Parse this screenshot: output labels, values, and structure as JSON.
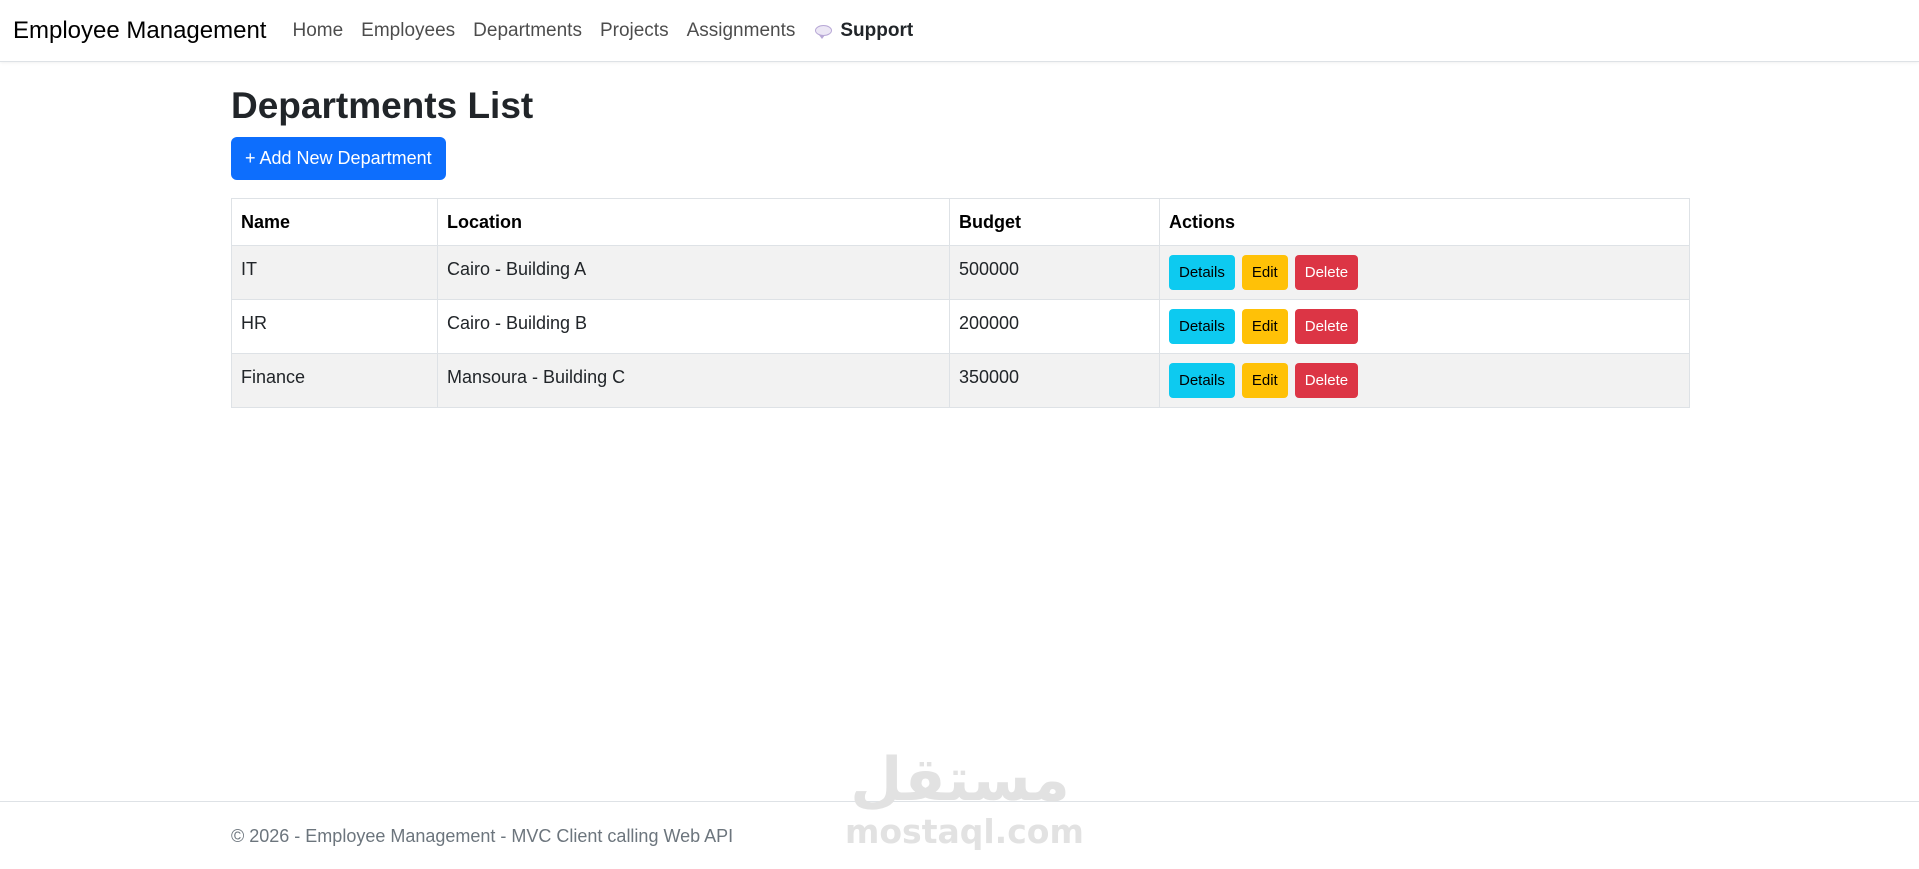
{
  "navbar": {
    "brand": "Employee Management",
    "links": [
      "Home",
      "Employees",
      "Departments",
      "Projects",
      "Assignments"
    ],
    "support": {
      "label": "Support",
      "icon": "speech-bubble-icon"
    }
  },
  "main": {
    "title": "Departments List",
    "add_button": "+ Add New Department",
    "table": {
      "headers": [
        "Name",
        "Location",
        "Budget",
        "Actions"
      ],
      "rows": [
        {
          "name": "IT",
          "location": "Cairo - Building A",
          "budget": "500000"
        },
        {
          "name": "HR",
          "location": "Cairo - Building B",
          "budget": "200000"
        },
        {
          "name": "Finance",
          "location": "Mansoura - Building C",
          "budget": "350000"
        }
      ],
      "actions": {
        "details": "Details",
        "edit": "Edit",
        "delete": "Delete"
      }
    }
  },
  "footer": {
    "text": "© 2026 - Employee Management - MVC Client calling Web API"
  },
  "watermark": {
    "arabic": "مستقل",
    "latin": "mostaql.com"
  },
  "colors": {
    "primary": "#0d6efd",
    "info": "#0dcaf0",
    "warning": "#ffc107",
    "danger": "#dc3545"
  }
}
